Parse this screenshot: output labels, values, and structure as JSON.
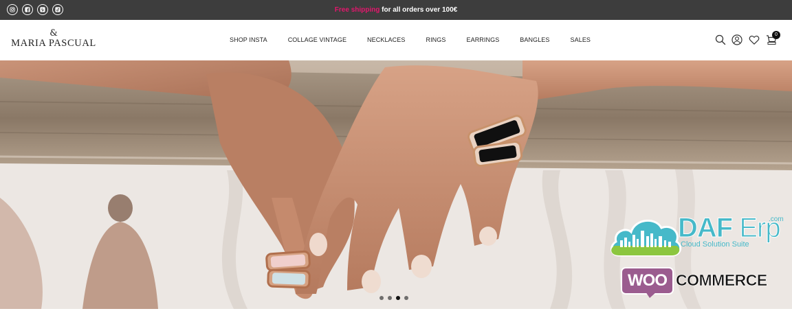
{
  "topbar": {
    "social_icons": [
      "instagram-icon",
      "facebook-icon",
      "pinterest-icon",
      "tiktok-icon"
    ],
    "promo_highlight": "Free shipping",
    "promo_text": "for all orders over 100€",
    "colors": {
      "background": "#3d3d3d",
      "highlight": "#e3176d"
    }
  },
  "header": {
    "logo_symbol": "&",
    "logo_name": "MARIA PASCUAL",
    "nav": [
      {
        "label": "SHOP INSTA"
      },
      {
        "label": "COLLAGE VINTAGE"
      },
      {
        "label": "NECKLACES"
      },
      {
        "label": "RINGS"
      },
      {
        "label": "EARRINGS"
      },
      {
        "label": "BANGLES"
      },
      {
        "label": "SALES"
      }
    ],
    "icons": [
      "search-icon",
      "account-icon",
      "wishlist-heart-icon",
      "cart-icon"
    ],
    "cart_count": "0"
  },
  "hero": {
    "slides_total": 4,
    "active_slide": 3
  },
  "overlay": {
    "daf_brand": "DAF",
    "daf_brand_suffix": "Erp",
    "daf_domain": ".com",
    "daf_tagline": "Cloud Solution Suite",
    "woo_badge": "WOO",
    "woo_text": "COMMERCE",
    "colors": {
      "daf": "#46b9c9",
      "woo": "#9b5c8f"
    }
  }
}
